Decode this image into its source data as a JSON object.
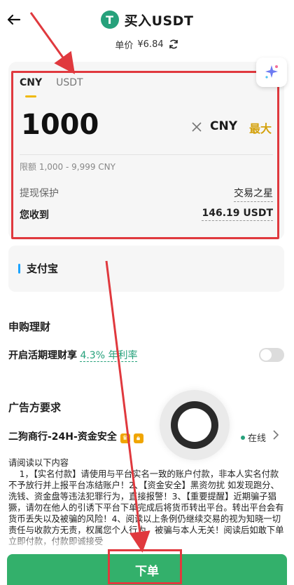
{
  "header": {
    "title": "买入USDT",
    "price_label": "单价",
    "price_value": "¥6.84",
    "tether_glyph": "T"
  },
  "card": {
    "tabs": [
      "CNY",
      "USDT"
    ],
    "amount": "1000",
    "currency": "CNY",
    "max_label": "最大",
    "limit": "限额 1,000 - 9,999 CNY",
    "protect_label": "提现保护",
    "protect_value": "交易之星",
    "receive_label": "您收到",
    "receive_value": "146.19 USDT"
  },
  "payment": {
    "label": "支付宝"
  },
  "wealth": {
    "title": "申购理财",
    "toggle_text": "开启活期理财享",
    "rate": "4.3% 年利率",
    "enabled": false
  },
  "advertiser": {
    "title": "广告方要求",
    "merchant": "二狗商行-24H-资金安全",
    "status": "在线",
    "terms": "请阅读以下内容\n    1，【实名付款】请使用与平台实名一致的账户付款，非本人实名付款不予放行并上报平台冻结账户！2、【资金安全】黑资勿扰 如发现跑分、洗钱、资金盘等违法犯罪行为，直接报警！3、【重要提醒】近期骗子猖獗，请勿在他人的引诱下平台下单完成后将货币转出平台。转出平台会有货币丢失以及被骗的风险！4、阅读以上条例仍继续交易的视为知晓一切责任与收款方无责，权属您个人行为。被骗与本人无关！阅读后如敢下单立即付款，付款即诚接受"
  },
  "bottom": {
    "order_label": "下单"
  },
  "colors": {
    "accent": "#f0b90b",
    "green": "#33b06b",
    "annotation_red": "#e0393e",
    "tether": "#26a17b"
  }
}
